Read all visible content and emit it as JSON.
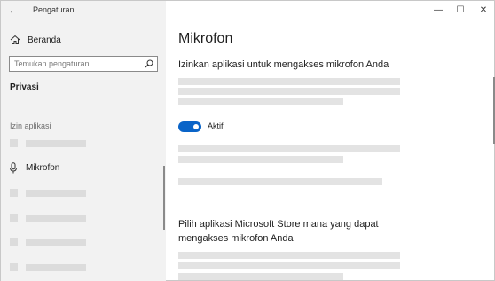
{
  "window": {
    "app_title": "Pengaturan",
    "controls": {
      "minimize": "—",
      "maximize": "☐",
      "close": "✕"
    }
  },
  "sidebar": {
    "back_icon": "←",
    "home_label": "Beranda",
    "search": {
      "placeholder": "Temukan pengaturan"
    },
    "section_label": "Privasi",
    "group_label": "Izin aplikasi",
    "active_item_label": "Mikrofon"
  },
  "main": {
    "title": "Mikrofon",
    "section1_heading": "Izinkan aplikasi untuk mengakses mikrofon Anda",
    "toggle": {
      "state_label": "Aktif",
      "on": true
    },
    "section2_heading": "Pilih aplikasi Microsoft Store mana yang dapat mengakses mikrofon Anda"
  },
  "colors": {
    "accent": "#0a64c8",
    "sidebar_bg": "#f2f2f2",
    "placeholder": "#e3e3e3"
  }
}
